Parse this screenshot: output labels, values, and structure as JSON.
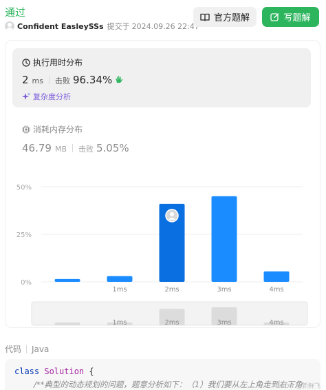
{
  "status": "通过",
  "submission": {
    "user": "Confident EasleySSs",
    "submitted_prefix": "提交于",
    "datetime": "2024.09.26 22:47"
  },
  "buttons": {
    "official": "官方题解",
    "write": "写题解"
  },
  "runtime": {
    "title": "执行用时分布",
    "value": "2",
    "unit": "ms",
    "beat_label": "击败",
    "beat_pct": "96.34%",
    "complexity_label": "复杂度分析"
  },
  "memory": {
    "title": "消耗内存分布",
    "value": "46.79",
    "unit": "MB",
    "beat_label": "击败",
    "beat_pct": "5.05%"
  },
  "chart_data": {
    "type": "bar",
    "categories": [
      "",
      "1ms",
      "2ms",
      "3ms",
      "4ms"
    ],
    "values": [
      1.5,
      3,
      41,
      45,
      5.5
    ],
    "highlight_index": 2,
    "yticks": [
      "50%",
      "25%",
      "0%"
    ],
    "ylim": [
      0,
      50
    ],
    "grid": true,
    "colors": {
      "bar": "#1a8cff",
      "highlight": "#0a6fe0"
    },
    "minimap_labels": [
      "1ms",
      "2ms",
      "3ms",
      "4ms"
    ]
  },
  "code": {
    "label": "代码",
    "language": "Java",
    "line1_kw": "class",
    "line1_name": "Solution",
    "line1_brace": "{",
    "line2_comment": "/**典型的动态规划的问题，题意分析如下：（1）我们要从左上角走到右下角"
  },
  "watermark": "CSDN @新鲜飞"
}
